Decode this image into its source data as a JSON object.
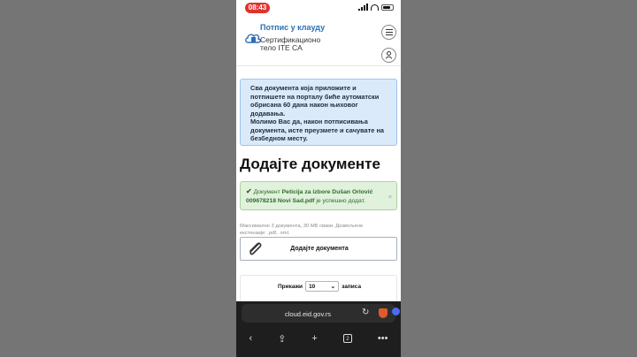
{
  "status_bar": {
    "time": "08:43"
  },
  "header": {
    "title": "Потпис у клауду",
    "subtitle": "Сертификационо тело ITE CA",
    "menu_icon": "hamburger-icon",
    "user_icon": "user-icon"
  },
  "info_alert": {
    "line1": "Сва документа која приложите и потпишете на порталу биће аутоматски обрисана 60 дана након њиховог додавања.",
    "line2": "Молимо Вас да, након потписивања документа, исте преузмете и сачувате на безбедном месту."
  },
  "page_heading": "Додајте документе",
  "success_alert": {
    "prefix": "Документ",
    "filename": "Peticija za izbore Dušan Orlović 009678218 Novi Sad.pdf",
    "suffix": "је успешно додат.",
    "close": "×"
  },
  "upload_hint": "Максимално 3 документа, 30 МБ сваки. Дозвољене екстензије: .pdf, .xml.",
  "upload_button": {
    "label": "Додајте документа",
    "icon": "paperclip-icon"
  },
  "table_controls": {
    "show_label": "Прикажи",
    "page_size": "10",
    "records_label": "записа"
  },
  "browser": {
    "url": "cloud.eid.gov.rs",
    "tab_count": "2",
    "tab_badge": "9"
  }
}
